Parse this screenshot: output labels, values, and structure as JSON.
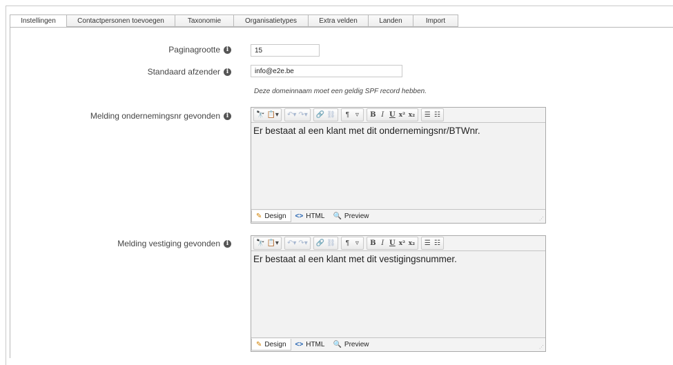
{
  "tabs": [
    {
      "label": "Instellingen",
      "active": true
    },
    {
      "label": "Contactpersonen toevoegen",
      "active": false
    },
    {
      "label": "Taxonomie",
      "active": false
    },
    {
      "label": "Organisatietypes",
      "active": false
    },
    {
      "label": "Extra velden",
      "active": false
    },
    {
      "label": "Landen",
      "active": false
    },
    {
      "label": "Import",
      "active": false
    }
  ],
  "form": {
    "paginagrootte": {
      "label": "Paginagrootte",
      "value": "15"
    },
    "afzender": {
      "label": "Standaard afzender",
      "value": "info@e2e.be"
    },
    "afzender_hint": "Deze domeinnaam moet een geldig SPF record hebben.",
    "melding_onderneming": {
      "label": "Melding ondernemingsnr gevonden",
      "content": "Er bestaat al een klant met dit ondernemingsnr/BTWnr."
    },
    "melding_vestiging": {
      "label": "Melding vestiging gevonden",
      "content": "Er bestaat al een klant met dit vestigingsnummer."
    }
  },
  "editor_modes": {
    "design": "Design",
    "html": "HTML",
    "preview": "Preview",
    "active": "Design"
  },
  "info_glyph": "i",
  "colors": {
    "border": "#b8b8b8",
    "info_icon": "#555555",
    "editor_bg": "#f2f2f2"
  }
}
